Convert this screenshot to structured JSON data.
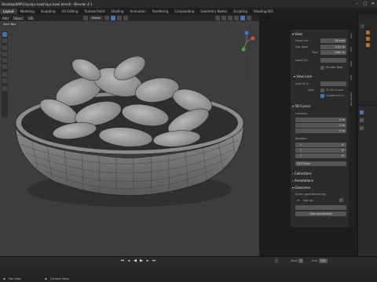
{
  "window": {
    "title": "Desktop\\WIP\\Chips\\ps bowl\\lays bowl.blend] - Blender 4.1"
  },
  "workspace_tabs": [
    {
      "label": "Layout",
      "active": true
    },
    {
      "label": "Modeling",
      "active": false
    },
    {
      "label": "Sculpting",
      "active": false
    },
    {
      "label": "UV Editing",
      "active": false
    },
    {
      "label": "Texture Paint",
      "active": false
    },
    {
      "label": "Shading",
      "active": false
    },
    {
      "label": "Animation",
      "active": false
    },
    {
      "label": "Rendering",
      "active": false
    },
    {
      "label": "Compositing",
      "active": false
    },
    {
      "label": "Geometry Nodes",
      "active": false
    },
    {
      "label": "Scripting",
      "active": false
    },
    {
      "label": "Shading.001",
      "active": false
    }
  ],
  "header": {
    "menu": [
      "Add",
      "Object",
      "GIS"
    ],
    "orientation": "Global",
    "select_box": "elect Box"
  },
  "npanel": {
    "view_section": "View",
    "focal_label": "Focal Len...",
    "focal_value": "50 mm",
    "clip_start_label": "Clip Start",
    "clip_start_value": "0.01 m",
    "clip_end_label": "End",
    "clip_end_value": "1000 m",
    "local_camera_label": "Local Ca...",
    "render_region_label": "Render Regi...",
    "view_lock_section": "View Lock",
    "lock_to_object_label": "Lock to O...",
    "lock_label": "Lock",
    "to_3d_cursor": "To 3D Cursor",
    "camera_to_view": "Camera to V...",
    "cursor_section": "3D Cursor",
    "location_label": "Location:",
    "loc_x_label": "X",
    "loc_x": "0 m",
    "loc_y_label": "Y",
    "loc_y": "0 m",
    "loc_z_label": "Z",
    "loc_z": "0 m",
    "rotation_label": "Rotation:",
    "rot_x_label": "X",
    "rot_x": "0°",
    "rot_y_label": "Y",
    "rot_y": "0°",
    "rot_z_label": "Z",
    "rot_z": "0°",
    "rot_mode": "XYZ Euler",
    "collections_section": "Collections",
    "annotations_section": "Annotations",
    "geoscene_section": "Geoscene",
    "geo_label": "Scene georeferencing :",
    "crs_value": "Not set",
    "geo_coords_btn": "Geo coordinates"
  },
  "side_tabs": [
    "Item",
    "Tool",
    "View",
    "Edit",
    "BlenderGIS"
  ],
  "timeline": {
    "start_label": "Start",
    "start": "1",
    "end_label": "End",
    "end": "250"
  },
  "status": {
    "left": "Pan View",
    "middle": "Context Menu"
  },
  "colors": {
    "accent": "#4772b3",
    "viewport": "#3d3d3d",
    "panel": "#2b2b2b"
  }
}
